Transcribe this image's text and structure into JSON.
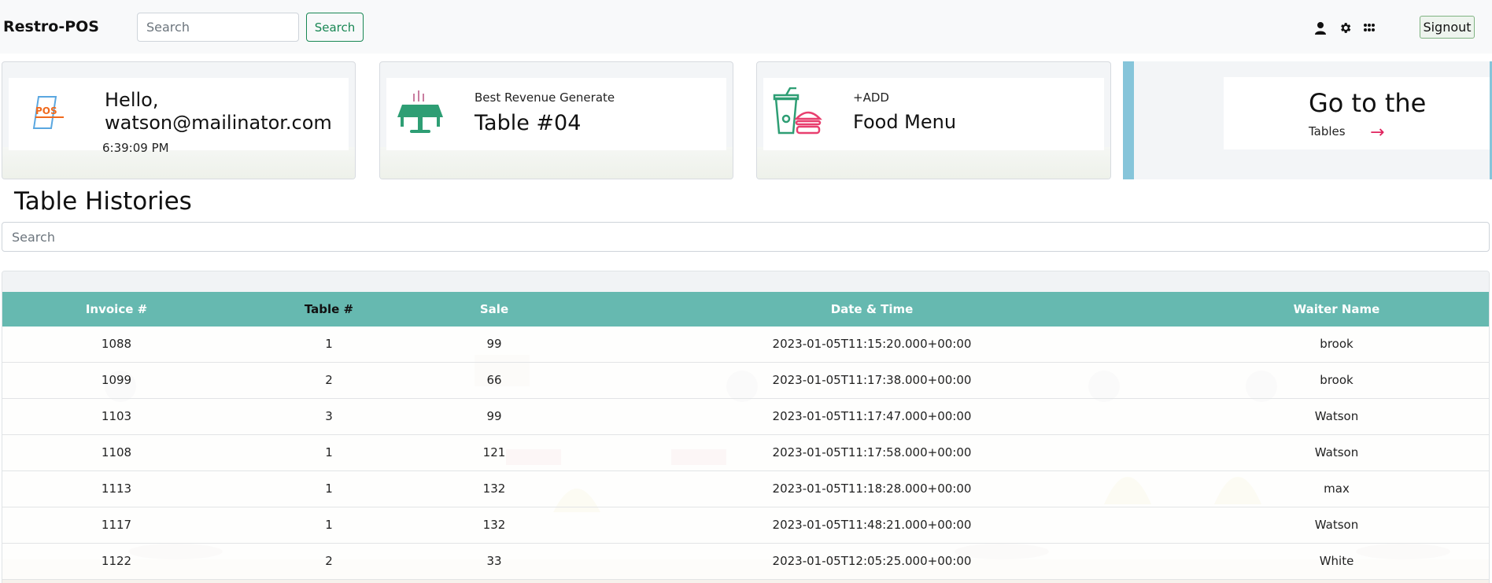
{
  "navbar": {
    "brand": "Restro-POS",
    "search_placeholder": "Search",
    "search_button": "Search",
    "signout_button": "Signout"
  },
  "cards": {
    "hello": {
      "title": "Hello, watson@mailinator.com",
      "time": "6:39:09 PM",
      "logo_text": "POS"
    },
    "revenue": {
      "label": "Best Revenue Generate",
      "value": "Table #04"
    },
    "food": {
      "label": "+ADD",
      "value": "Food Menu"
    },
    "goto": {
      "title": "Go to the",
      "subtitle": "Tables",
      "arrow": "→"
    }
  },
  "section_title": "Table Histories",
  "table": {
    "search_placeholder": "Search",
    "headers": [
      "Invoice #",
      "Table #",
      "Sale",
      "Date & Time",
      "Waiter Name"
    ],
    "rows": [
      [
        "1088",
        "1",
        "99",
        "2023-01-05T11:15:20.000+00:00",
        "brook"
      ],
      [
        "1099",
        "2",
        "66",
        "2023-01-05T11:17:38.000+00:00",
        "brook"
      ],
      [
        "1103",
        "3",
        "99",
        "2023-01-05T11:17:47.000+00:00",
        "Watson"
      ],
      [
        "1108",
        "1",
        "121",
        "2023-01-05T11:17:58.000+00:00",
        "Watson"
      ],
      [
        "1113",
        "1",
        "132",
        "2023-01-05T11:18:28.000+00:00",
        "max"
      ],
      [
        "1117",
        "1",
        "132",
        "2023-01-05T11:48:21.000+00:00",
        "Watson"
      ],
      [
        "1122",
        "2",
        "33",
        "2023-01-05T12:05:25.000+00:00",
        "White"
      ]
    ]
  },
  "colors": {
    "table_header": "#66b9b0",
    "accent_green": "#198754",
    "accent_pink": "#e0245e",
    "goto_border": "#86c5da"
  }
}
